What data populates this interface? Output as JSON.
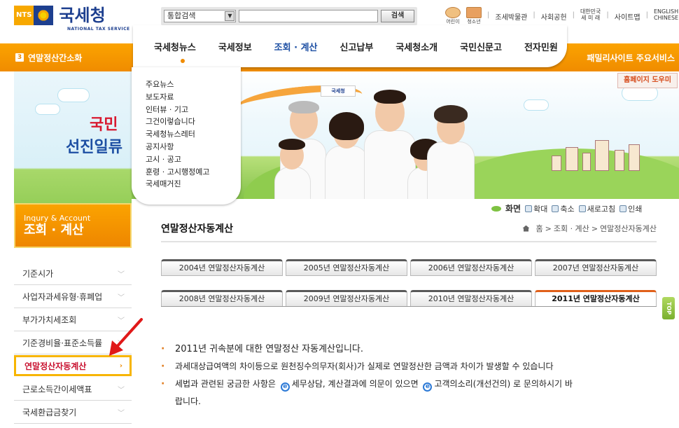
{
  "header": {
    "logo_abbr": "NTS",
    "logo_name": "국세청",
    "logo_sub": "NATIONAL TAX SERVICE",
    "search_scope": "통합검색",
    "search_value": "",
    "search_button": "검색",
    "util_kids": "어린이",
    "util_teen": "청소년",
    "util_links": [
      "조세박물관",
      "사회공헌",
      "사이트맵"
    ],
    "util_korea_1": "대한민국",
    "util_korea_2": "세 미 래",
    "util_lang_1": "ENGLISH",
    "util_lang_2": "CHINESE"
  },
  "band": {
    "quick_num": "3",
    "quick_label": "연말정산간소화",
    "family_sites": "패밀리사이트 주요서비스"
  },
  "gnb": [
    "국세청뉴스",
    "국세정보",
    "조회 · 계산",
    "신고납부",
    "국세청소개",
    "국민신문고",
    "전자민원"
  ],
  "submenu": [
    "주요뉴스",
    "보도자료",
    "인터뷰 · 기고",
    "그건이렇습니다",
    "국세청뉴스레터",
    "공지사항",
    "고시 · 공고",
    "훈령 · 고시행정예고",
    "국세매거진"
  ],
  "help_button": "홈페이지 도우미",
  "visual": {
    "slogan_1": "국민",
    "slogan_2": "선진일류",
    "flag_text": "국세청"
  },
  "lnb_title": {
    "en": "Inqury & Account",
    "ko": "조회 · 계산"
  },
  "lnb": [
    "기준시가",
    "사업자과세유형·휴폐업",
    "부가가치세조회",
    "기준경비율·표준소득률",
    "연말정산자동계산",
    "근로소득간이세액표",
    "국세환급금찾기"
  ],
  "tools": {
    "screen": "화면",
    "zoom_in": "확대",
    "zoom_out": "축소",
    "refresh": "새로고침",
    "print": "인쇄"
  },
  "content": {
    "title": "연말정산자동계산",
    "breadcrumb": [
      "홈",
      "조회 · 계산",
      "연말정산자동계산"
    ],
    "tabs_row1": [
      "2004년 연말정산자동계산",
      "2005년 연말정산자동계산",
      "2006년 연말정산자동계산",
      "2007년 연말정산자동계산"
    ],
    "tabs_row2": [
      "2008년 연말정산자동계산",
      "2009년 연말정산자동계산",
      "2010년 연말정산자동계산",
      "2011년 연말정산자동계산"
    ],
    "top_label": "TOP",
    "bullet_1": "2011년 귀속분에 대한 연말정산 자동계산입니다.",
    "bullet_2": "과세대상급여액의 차이등으로 원천징수의무자(회사)가 실제로 연말정산한 금액과 차이가 발생할 수 있습니다",
    "bullet_3a": "세법과 관련된 궁금한 사항은",
    "bullet_3b": "세무상담, 계산결과에 의문이 있으면",
    "bullet_3c": "고객의소리(개선건의) 로 문의하시기 바",
    "bullet_3d": "랍니다."
  },
  "colors": {
    "accent_orange": "#f08c00",
    "brand_blue": "#1d3f8f",
    "active_red": "#c8102e"
  }
}
